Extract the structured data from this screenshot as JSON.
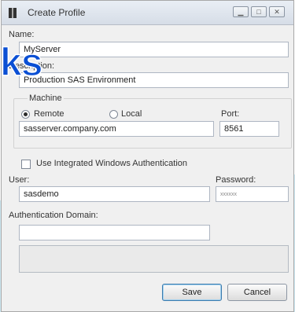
{
  "window": {
    "title": "Create Profile",
    "controls": [
      "minimize",
      "maximize",
      "close"
    ]
  },
  "form": {
    "name_label": "Name:",
    "name_value": "MyServer",
    "description_label": "Description:",
    "description_value": "Production SAS Environment",
    "machine_group_label": "Machine",
    "remote_label": "Remote",
    "local_label": "Local",
    "selected_machine": "Remote",
    "port_label": "Port:",
    "host_value": "sasserver.company.com",
    "port_value": "8561",
    "iwa_label": "Use Integrated Windows Authentication",
    "iwa_checked": false,
    "user_label": "User:",
    "user_value": "sasdemo",
    "password_label": "Password:",
    "password_value": "xxxxxx",
    "auth_domain_label": "Authentication Domain:",
    "auth_domain_value": ""
  },
  "buttons": {
    "save": "Save",
    "cancel": "Cancel"
  },
  "watermark": {
    "text": "ks",
    "color": "#0a4fd4"
  },
  "colors": {
    "accent_band": "#cfeaf4"
  }
}
